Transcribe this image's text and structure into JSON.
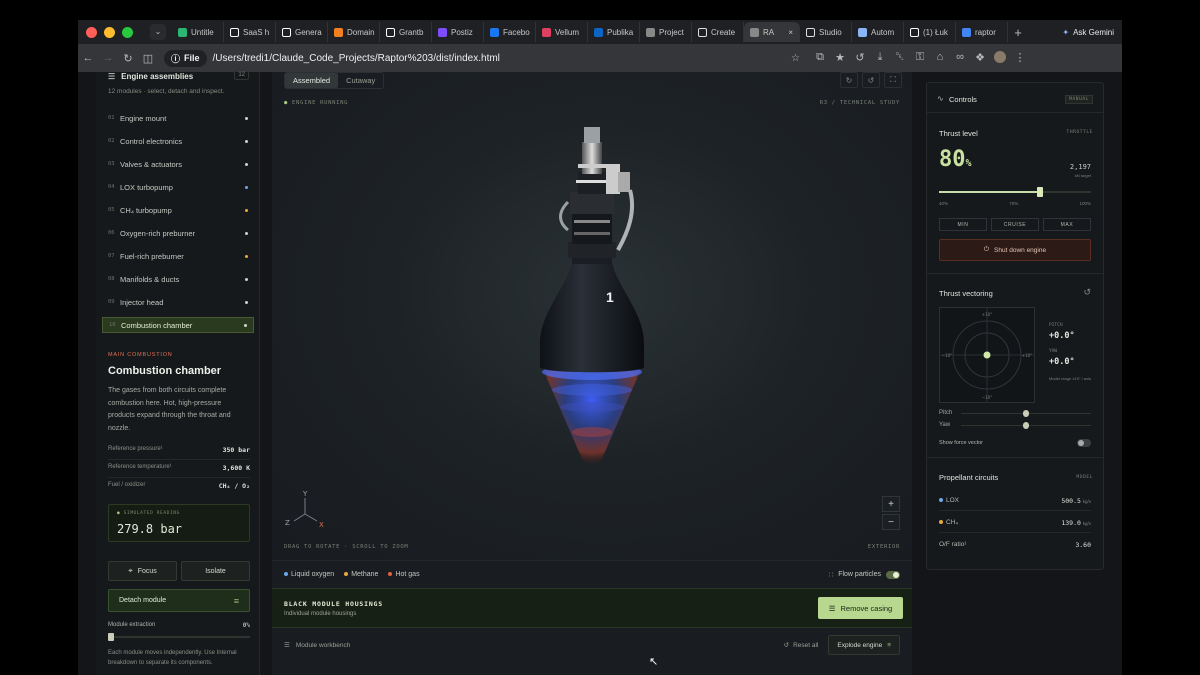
{
  "browser": {
    "tabs": [
      {
        "label": "Untitle",
        "icon": "green-bolt-icon",
        "color": "#2bb673"
      },
      {
        "label": "SaaS h",
        "icon": "github-icon",
        "color": "#ffffff"
      },
      {
        "label": "Genera",
        "icon": "triangle-icon",
        "color": "#ffffff"
      },
      {
        "label": "Domain",
        "icon": "cloudflare-icon",
        "color": "#f38020"
      },
      {
        "label": "Grantb",
        "icon": "triangle-icon",
        "color": "#ffffff"
      },
      {
        "label": "Postiz",
        "icon": "postiz-icon",
        "color": "#7c4dff"
      },
      {
        "label": "Facebo",
        "icon": "facebook-icon",
        "color": "#1877f2"
      },
      {
        "label": "Vellum",
        "icon": "vellum-icon",
        "color": "#e04060"
      },
      {
        "label": "Publika",
        "icon": "linkedin-icon",
        "color": "#0a66c2"
      },
      {
        "label": "Project",
        "icon": "page-icon",
        "color": "#888888"
      },
      {
        "label": "Create",
        "icon": "notion-icon",
        "color": "#dddddd"
      },
      {
        "label": "RA",
        "icon": "globe-icon",
        "color": "#888888",
        "active": true
      },
      {
        "label": "Studio",
        "icon": "studio-icon",
        "color": "#dddddd"
      },
      {
        "label": "Autom",
        "icon": "gemini-icon",
        "color": "#8ab4f8"
      },
      {
        "label": "(1) Łuk",
        "icon": "x-icon",
        "color": "#ffffff"
      },
      {
        "label": "raptor",
        "icon": "google-icon",
        "color": "#4285f4"
      }
    ],
    "ask_gemini": "Ask Gemini",
    "scheme_chip": "File",
    "url": "/Users/tredi1/Claude_Code_Projects/Raptor%203/dist/index.html"
  },
  "left": {
    "title": "Engine assemblies",
    "count": "12",
    "subtitle": "12 modules · select, detach and inspect.",
    "modules": [
      {
        "n": "01",
        "label": "Engine mount",
        "dot": "#cfd4c4"
      },
      {
        "n": "02",
        "label": "Control electronics",
        "dot": "#cfd4c4"
      },
      {
        "n": "03",
        "label": "Valves & actuators",
        "dot": "#cfd4c4"
      },
      {
        "n": "04",
        "label": "LOX turbopump",
        "dot": "#6aa8e8"
      },
      {
        "n": "05",
        "label": "CH₄ turbopump",
        "dot": "#e8a840"
      },
      {
        "n": "06",
        "label": "Oxygen-rich preburner",
        "dot": "#cfd4c4"
      },
      {
        "n": "07",
        "label": "Fuel-rich preburner",
        "dot": "#e8a840"
      },
      {
        "n": "08",
        "label": "Manifolds & ducts",
        "dot": "#cfd4c4"
      },
      {
        "n": "09",
        "label": "Injector head",
        "dot": "#cfd4c4"
      },
      {
        "n": "10",
        "label": "Combustion chamber",
        "dot": "#cfd4c4",
        "selected": true
      }
    ],
    "section": "MAIN COMBUSTION",
    "component_title": "Combustion chamber",
    "description": "The gases from both circuits complete combustion here. Hot, high-pressure products expand through the throat and nozzle.",
    "specs": [
      {
        "k": "Reference pressure¹",
        "v": "350 bar"
      },
      {
        "k": "Reference temperature¹",
        "v": "3,600 K"
      },
      {
        "k": "Fuel / oxidizer",
        "v": "CH₄ / O₂"
      }
    ],
    "reading_label": "SIMULATED READING",
    "reading_value": "279.8 bar",
    "focus_label": "Focus",
    "isolate_label": "Isolate",
    "detach_label": "Detach module",
    "extraction_label": "Module extraction",
    "extraction_value": "0%",
    "extraction_fraction": 0.0,
    "extraction_note": "Each module moves independently. Use Internal breakdown to separate its components."
  },
  "center": {
    "views": [
      {
        "label": "Assembled",
        "on": true
      },
      {
        "label": "Cutaway",
        "on": false
      }
    ],
    "status": "ENGINE RUNNING",
    "study": "R3 / TECHNICAL STUDY",
    "nozzle_mark": "1",
    "axes": {
      "y": "Y",
      "z": "Z",
      "x": "X"
    },
    "hint": "DRAG TO ROTATE  ·  SCROLL TO ZOOM",
    "view_mode": "EXTERIOR",
    "zoom_in": "+",
    "zoom_out": "−",
    "legend": [
      {
        "label": "Liquid oxygen",
        "color": "#6aa8e8"
      },
      {
        "label": "Methane",
        "color": "#e8a840"
      },
      {
        "label": "Hot gas",
        "color": "#e06040"
      }
    ],
    "flow_particles": "Flow particles",
    "banner_title": "BLACK MODULE HOUSINGS",
    "banner_sub": "Individual module housings",
    "remove_casing": "Remove casing",
    "workbench": "Module workbench",
    "reset_all": "Reset all",
    "explode": "Explode engine"
  },
  "controls": {
    "title": "Controls",
    "mode": "MANUAL",
    "thrust_label": "Thrust level",
    "throttle_tag": "THROTTLE",
    "thrust_value": "80",
    "thrust_unit": "%",
    "thrust_kn": "2,197",
    "thrust_kn_unit": "kN target",
    "throttle_fraction": 0.667,
    "ticks": [
      "40%",
      "70%",
      "100%"
    ],
    "presets": [
      "MIN",
      "CRUISE",
      "MAX"
    ],
    "shutdown": "Shut down engine",
    "vector_title": "Thrust vectoring",
    "gimbal_ticks": {
      "top": "+10°",
      "bottom": "−10°",
      "left": "−10°",
      "right": "+10°"
    },
    "pitch_label": "PITCH",
    "pitch_value": "+0.0°",
    "yaw_label": "YAW",
    "yaw_value": "+0.0°",
    "model_range": "Model range ±10° / axis",
    "pitch_slider": "Pitch",
    "yaw_slider": "Yaw",
    "pitch_fraction": 0.5,
    "yaw_fraction": 0.5,
    "show_force": "Show force vector",
    "prop_title": "Propellant circuits",
    "prop_tag": "MODEL",
    "prop": [
      {
        "label": "LOX",
        "value": "500.5",
        "unit": "kg/s",
        "color": "#6aa8e8"
      },
      {
        "label": "CH₄",
        "value": "139.0",
        "unit": "kg/s",
        "color": "#e8a840"
      },
      {
        "label": "O/F ratio¹",
        "value": "3.60",
        "unit": ""
      }
    ]
  }
}
